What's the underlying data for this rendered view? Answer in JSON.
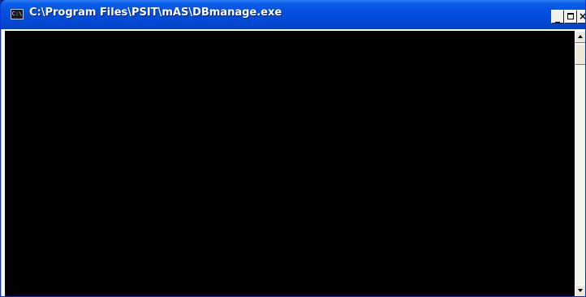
{
  "window": {
    "title": "C:\\Program Files\\PSIT\\mAS\\DBmanage.exe",
    "icon": "console-window-icon",
    "icon_glyph": "C:\\",
    "console_background": "#000000",
    "titlebar_color": "#0550e0"
  },
  "caption_buttons": {
    "minimize_glyph": "_",
    "close_glyph": "×"
  },
  "console": {
    "output": ""
  }
}
